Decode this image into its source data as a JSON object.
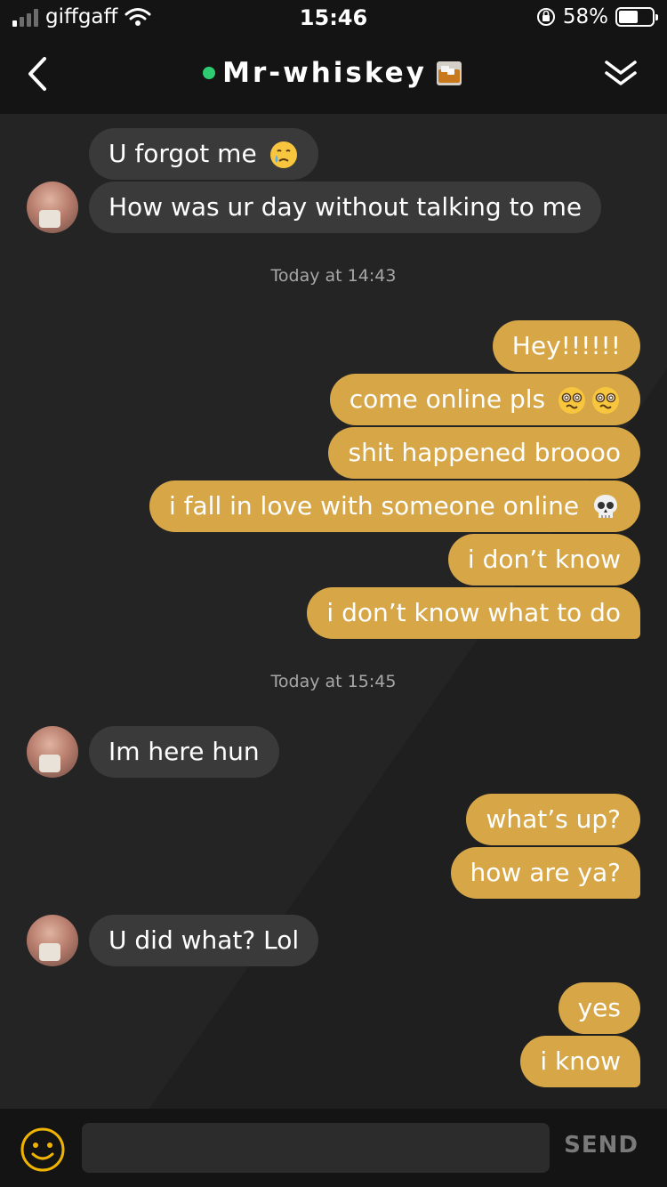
{
  "status_bar": {
    "carrier": "giffgaff",
    "time": "15:46",
    "battery": "58%",
    "battery_level": 0.58
  },
  "header": {
    "title": "Mr-whiskey",
    "title_icon": "whiskey-glass-icon",
    "back_icon": "chevron-left-icon",
    "collapse_icon": "double-chevron-down-icon",
    "online_color": "#2ecc71"
  },
  "messages": {
    "m1": "U forgot me",
    "m2": "How was ur day without talking to me",
    "ts1": "Today at 14:43",
    "m3": "Hey!!!!!!",
    "m4": "come online pls",
    "m5": "shit happened broooo",
    "m6": "i fall in love with someone online",
    "m7": "i don’t know",
    "m8": "i don’t know what to do",
    "ts2": "Today at 15:45",
    "m9": "Im here hun",
    "m10": "what’s up?",
    "m11": "how are ya?",
    "m12": "U did what? Lol",
    "m13": "yes",
    "m14": "i know"
  },
  "emoji": {
    "m1": "crying-face-icon",
    "m4": "dizzy-face-icon",
    "m6": "skull-icon"
  },
  "composer": {
    "placeholder": "",
    "send_label": "SEND",
    "emoji_icon": "smiley-icon"
  },
  "colors": {
    "outgoing_bubble": "#d6a647",
    "incoming_bubble": "#3a3a3a",
    "background": "#1c1c1c"
  }
}
